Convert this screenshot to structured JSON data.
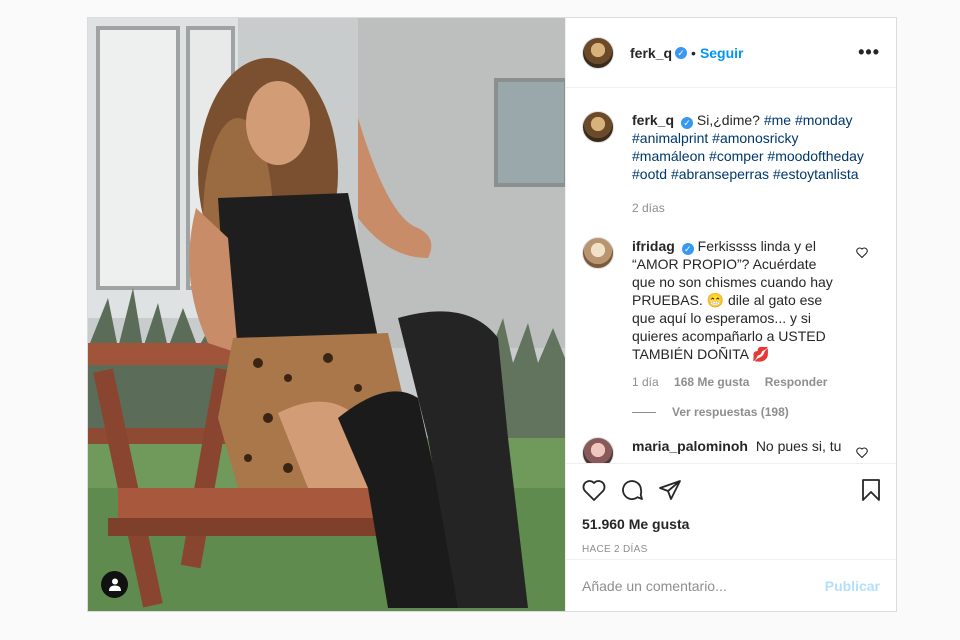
{
  "header": {
    "username": "ferk_q",
    "follow_label": "Seguir",
    "separator": "•"
  },
  "caption": {
    "username": "ferk_q",
    "text_plain": "Si,¿dime?",
    "hashtags": [
      "#me",
      "#monday",
      "#animalprint",
      "#amonosricky",
      "#mamáleon",
      "#comper",
      "#moodoftheday",
      "#ootd",
      "#abranseperras",
      "#estoytanlista"
    ],
    "time": "2 días"
  },
  "comments": [
    {
      "username": "ifridag",
      "text": "Ferkissss linda y el “AMOR PROPIO”? Acuérdate que no son chismes cuando hay PRUEBAS. 😁 dile al gato ese que aquí lo esperamos... y si quieres acompañarlo a USTED TAMBIÉN DOÑITA 💋",
      "time": "1 día",
      "likes": "168 Me gusta",
      "reply": "Responder",
      "view_replies": "Ver respuestas (198)"
    },
    {
      "username": "maria_palominoh",
      "text": "No pues si, tu"
    }
  ],
  "actions": {
    "like_icon": "heart-icon",
    "comment_icon": "comment-icon",
    "share_icon": "share-icon",
    "save_icon": "bookmark-icon"
  },
  "stats": {
    "likes": "51.960 Me gusta",
    "posted": "HACE 2 DÍAS"
  },
  "comment_box": {
    "placeholder": "Añade un comentario...",
    "publish": "Publicar"
  },
  "colors": {
    "link": "#0095f6",
    "hashtag": "#00376b",
    "muted": "#8e8e8e"
  }
}
